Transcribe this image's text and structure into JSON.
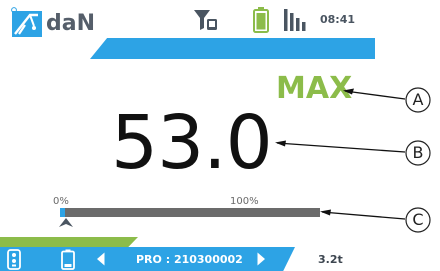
{
  "status_bar": {
    "logo_icon": "crane-weighing-logo-icon",
    "unit": "daN",
    "filter_icon": "filter-device-icon",
    "battery_icon": "battery-icon",
    "battery_color": "#8cbc4a",
    "signal_icon": "signal-bars-icon",
    "time": "08:41"
  },
  "readout": {
    "mode": "MAX",
    "value": "53.0"
  },
  "progress": {
    "min_label": "0%",
    "max_label": "100%",
    "fraction": 0.02
  },
  "callouts": {
    "a": "A",
    "b": "B",
    "c": "C"
  },
  "bottom_bar": {
    "sensor_icon": "sensor-remote-icon",
    "device_icon": "device-battery-icon",
    "prev_icon": "chevron-left-icon",
    "device_id": "PRO : 210300002",
    "next_icon": "chevron-right-icon",
    "capacity": "3.2t"
  },
  "colors": {
    "accent_blue": "#2da3e5",
    "accent_green": "#8cbc4a",
    "track_gray": "#6b6b6b"
  }
}
